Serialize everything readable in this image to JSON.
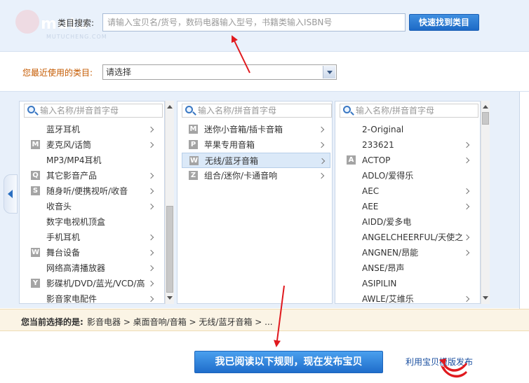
{
  "search": {
    "label": "类目搜索:",
    "placeholder": "请输入宝贝名/货号，数码电器输入型号，书籍类输入ISBN号",
    "button": "快速找到类目"
  },
  "recent": {
    "label": "您最近使用的类目:",
    "selected": "请选择"
  },
  "filter_placeholder": "输入名称/拼音首字母",
  "columns": [
    {
      "items": [
        {
          "letter": "",
          "name": "蓝牙耳机",
          "has_children": true
        },
        {
          "letter": "M",
          "name": "麦克风/话筒",
          "has_children": true
        },
        {
          "letter": "",
          "name": "MP3/MP4耳机",
          "has_children": false
        },
        {
          "letter": "Q",
          "name": "其它影音产品",
          "has_children": true
        },
        {
          "letter": "S",
          "name": "随身听/便携视听/收音",
          "has_children": true
        },
        {
          "letter": "",
          "name": "收音头",
          "has_children": true
        },
        {
          "letter": "",
          "name": "数字电视机顶盒",
          "has_children": false
        },
        {
          "letter": "",
          "name": "手机耳机",
          "has_children": true
        },
        {
          "letter": "W",
          "name": "舞台设备",
          "has_children": true
        },
        {
          "letter": "",
          "name": "网络高清播放器",
          "has_children": true
        },
        {
          "letter": "Y",
          "name": "影碟机/DVD/蓝光/VCD/高",
          "has_children": true
        },
        {
          "letter": "",
          "name": "影音家电配件",
          "has_children": true
        }
      ]
    },
    {
      "items": [
        {
          "letter": "M",
          "name": "迷你小音箱/插卡音箱",
          "has_children": true
        },
        {
          "letter": "P",
          "name": "苹果专用音箱",
          "has_children": true
        },
        {
          "letter": "W",
          "name": "无线/蓝牙音箱",
          "has_children": true,
          "selected": true
        },
        {
          "letter": "Z",
          "name": "组合/迷你/卡通音响",
          "has_children": true
        }
      ]
    },
    {
      "items": [
        {
          "letter": "",
          "name": "2-Original",
          "has_children": false
        },
        {
          "letter": "",
          "name": "233621",
          "has_children": true
        },
        {
          "letter": "A",
          "name": "ACTOP",
          "has_children": true
        },
        {
          "letter": "",
          "name": "ADLO/爱得乐",
          "has_children": false
        },
        {
          "letter": "",
          "name": "AEC",
          "has_children": true
        },
        {
          "letter": "",
          "name": "AEE",
          "has_children": true
        },
        {
          "letter": "",
          "name": "AIDD/爱多电",
          "has_children": false
        },
        {
          "letter": "",
          "name": "ANGELCHEERFUL/天使之",
          "has_children": true
        },
        {
          "letter": "",
          "name": "ANGNEN/昂能",
          "has_children": true
        },
        {
          "letter": "",
          "name": "ANSE/昂声",
          "has_children": false
        },
        {
          "letter": "",
          "name": "ASIPILIN",
          "has_children": false
        },
        {
          "letter": "",
          "name": "AWLE/艾维乐",
          "has_children": true
        }
      ]
    }
  ],
  "current": {
    "label": "您当前选择的是:",
    "path": "影音电器 > 桌面音响/音箱 > 无线/蓝牙音箱 > ..."
  },
  "publish_button": "我已阅读以下规则，现在发布宝贝",
  "template_link": "利用宝贝模版发布",
  "watermark": {
    "text": "mutu",
    "url": "MUTUCHENG.COM"
  },
  "colors": {
    "accent_blue": "#1f6dcb",
    "label_orange": "#c55a00",
    "annotation_red": "#e0191e"
  }
}
